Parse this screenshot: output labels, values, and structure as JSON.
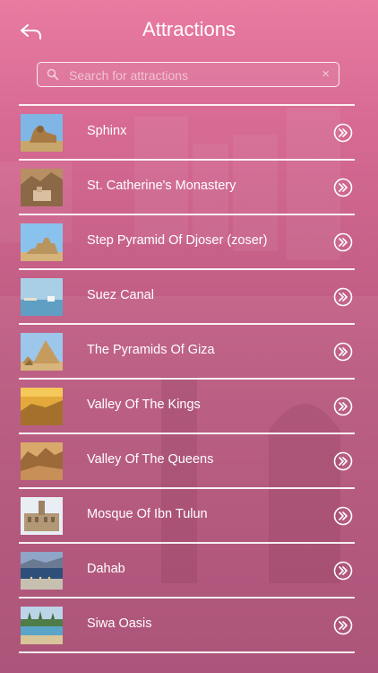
{
  "header": {
    "title": "Attractions",
    "back_icon": "back-arrow-icon"
  },
  "search": {
    "placeholder": "Search for attractions",
    "value": "",
    "clear_icon": "×"
  },
  "attractions": [
    {
      "label": "Sphinx",
      "thumb": "sphinx"
    },
    {
      "label": "St. Catherine's Monastery",
      "thumb": "monastery"
    },
    {
      "label": "Step Pyramid Of Djoser (zoser)",
      "thumb": "step-pyramid"
    },
    {
      "label": "Suez Canal",
      "thumb": "canal"
    },
    {
      "label": "The Pyramids Of Giza",
      "thumb": "pyramids"
    },
    {
      "label": "Valley Of The Kings",
      "thumb": "valley-kings"
    },
    {
      "label": "Valley Of The Queens",
      "thumb": "valley-queens"
    },
    {
      "label": "Mosque Of Ibn Tulun",
      "thumb": "mosque"
    },
    {
      "label": "Dahab",
      "thumb": "dahab"
    },
    {
      "label": "Siwa Oasis",
      "thumb": "siwa"
    }
  ],
  "colors": {
    "bg_top": "#e97ba1",
    "bg_bottom": "#a84b72",
    "text": "#ffffff"
  }
}
